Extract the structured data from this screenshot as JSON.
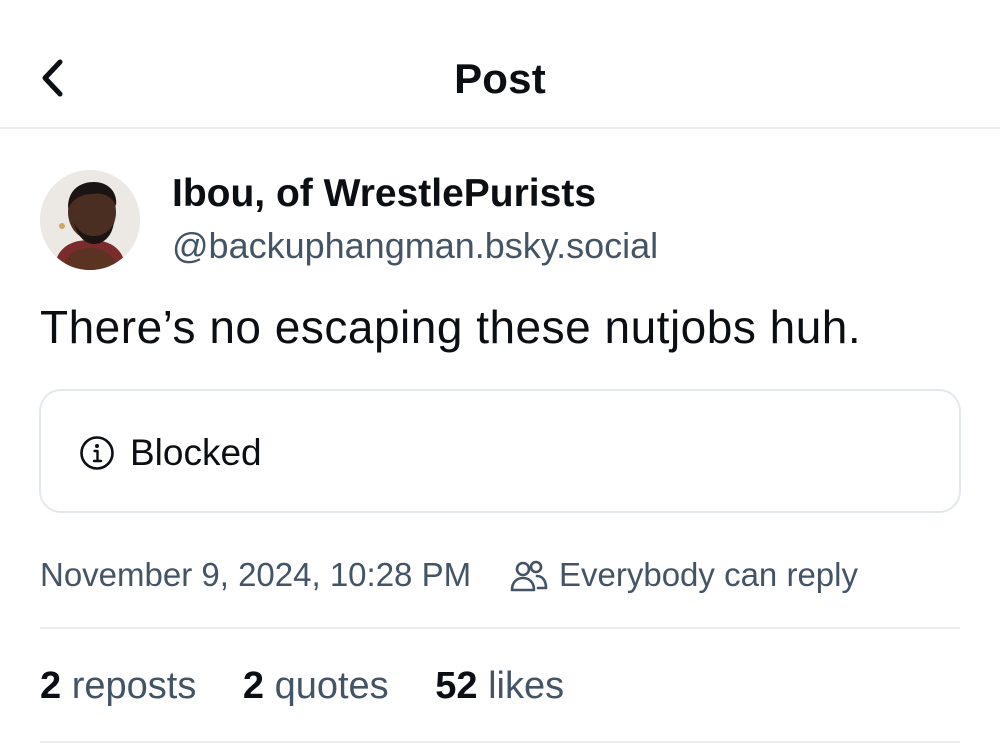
{
  "header": {
    "back_icon": "chevron-left-icon",
    "title": "Post"
  },
  "author": {
    "display_name": "Ibou, of WrestlePurists",
    "handle": "@backuphangman.bsky.social"
  },
  "post": {
    "text": "There’s no escaping these nutjobs huh."
  },
  "embed": {
    "icon": "info-icon",
    "label": "Blocked"
  },
  "meta": {
    "timestamp": "November 9, 2024, 10:28 PM",
    "reply_icon": "people-icon",
    "reply_setting": "Everybody can reply"
  },
  "stats": {
    "reposts_count": "2",
    "reposts_label": "reposts",
    "quotes_count": "2",
    "quotes_label": "quotes",
    "likes_count": "52",
    "likes_label": "likes"
  },
  "colors": {
    "text_primary": "#0b0f14",
    "text_secondary": "#425466",
    "border": "#e9edf1"
  }
}
